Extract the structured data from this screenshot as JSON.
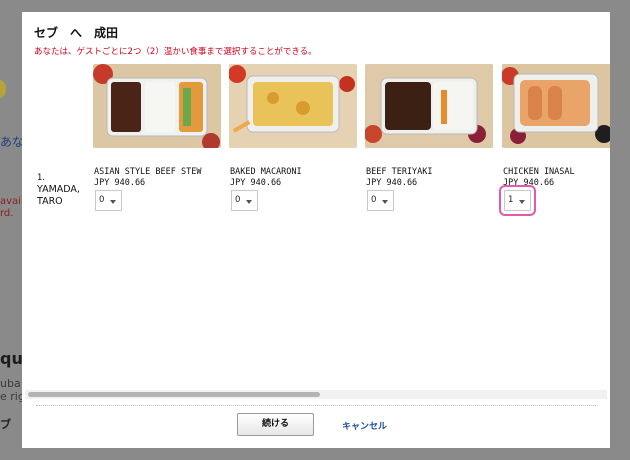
{
  "background": {
    "frag_top": "あ",
    "frag_link": "あな",
    "frag_red_1": "availal",
    "frag_red_2": "rd.",
    "frag_dark": "qui",
    "frag_small_1": "uba g",
    "frag_small_2": "e righ",
    "frag_small_3": "ブ"
  },
  "modal": {
    "title": "セブ　へ　成田",
    "notice": "あなたは、ゲストごとに2つ（2）温かい食事まで選択することができる。"
  },
  "passenger": {
    "number": "1.",
    "name": "YAMADA, TARO"
  },
  "meals": [
    {
      "name": "ASIAN STYLE BEEF STEW",
      "price": "JPY 940.66",
      "qty": "0",
      "selected": false
    },
    {
      "name": "BAKED MACARONI",
      "price": "JPY 940.66",
      "qty": "0",
      "selected": false
    },
    {
      "name": "BEEF TERIYAKI",
      "price": "JPY 940.66",
      "qty": "0",
      "selected": false
    },
    {
      "name": "CHICKEN INASAL",
      "price": "JPY 940.66",
      "qty": "1",
      "selected": true
    }
  ],
  "footer": {
    "continue_label": "続ける",
    "cancel_label": "キャンセル"
  },
  "colors": {
    "notice_red": "#d0021b",
    "link_blue": "#1a4fa0",
    "highlight_pink": "#e05ab0"
  }
}
